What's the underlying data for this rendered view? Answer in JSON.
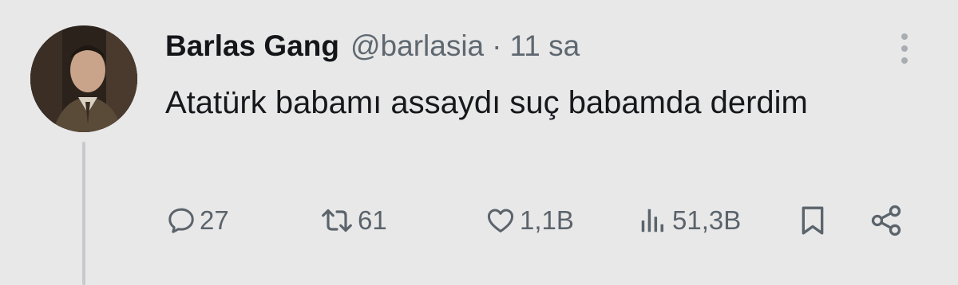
{
  "tweet": {
    "author": {
      "display_name": "Barlas Gang",
      "handle": "@barlasia"
    },
    "separator": "·",
    "time": "11 sa",
    "text": "Atatürk babamı assaydı suç babamda derdim"
  },
  "actions": {
    "reply_count": "27",
    "retweet_count": "61",
    "like_count": "1,1B",
    "view_count": "51,3B"
  },
  "icons": {
    "reply": "comment-bubble-icon",
    "retweet": "retweet-arrows-icon",
    "like": "heart-icon",
    "views": "bar-chart-icon",
    "bookmark": "bookmark-icon",
    "share": "share-nodes-icon",
    "more": "more-vertical-icon"
  },
  "colors": {
    "background": "#e8e8e9",
    "text": "#16181b",
    "secondary_text": "#5f6870",
    "thread_line": "#c7c9cc"
  }
}
